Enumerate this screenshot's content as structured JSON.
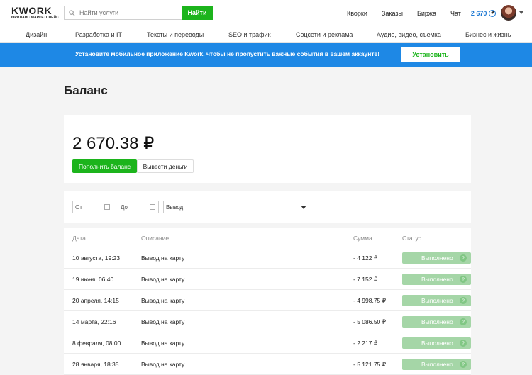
{
  "header": {
    "logo_main": "KWORK",
    "logo_sub": "ФРИЛАНС МАРКЕТПЛЕЙС",
    "search_placeholder": "Найти услуги",
    "search_button": "Найти",
    "nav": [
      "Кворки",
      "Заказы",
      "Биржа",
      "Чат"
    ],
    "balance": "2 670",
    "currency_icon": "ruble-icon"
  },
  "categories": [
    "Дизайн",
    "Разработка и IT",
    "Тексты и переводы",
    "SEO и трафик",
    "Соцсети и реклама",
    "Аудио, видео, съемка",
    "Бизнес и жизнь"
  ],
  "banner": {
    "text": "Установите мобильное приложение Kwork, чтобы не пропустить важные события в вашем аккаунте!",
    "button": "Установить",
    "color": "#1e88e5"
  },
  "page_title": "Баланс",
  "balance_card": {
    "amount": "2 670.38 ₽",
    "topup_button": "Пополнить баланс",
    "withdraw_button": "Вывести деньги"
  },
  "filters": {
    "from_placeholder": "От",
    "to_placeholder": "До",
    "type_selected": "Вывод"
  },
  "table": {
    "headers": [
      "Дата",
      "Описание",
      "Сумма",
      "Статус"
    ],
    "rows": [
      {
        "date": "10 августа, 19:23",
        "description": "Вывод на карту",
        "amount": "- 4 122 ₽",
        "status": "Выполнено"
      },
      {
        "date": "19 июня, 06:40",
        "description": "Вывод на карту",
        "amount": "- 7 152 ₽",
        "status": "Выполнено"
      },
      {
        "date": "20 апреля, 14:15",
        "description": "Вывод на карту",
        "amount": "- 4 998.75 ₽",
        "status": "Выполнено"
      },
      {
        "date": "14 марта, 22:16",
        "description": "Вывод на карту",
        "amount": "- 5 086.50 ₽",
        "status": "Выполнено"
      },
      {
        "date": "8 февраля, 08:00",
        "description": "Вывод на карту",
        "amount": "- 2 217 ₽",
        "status": "Выполнено"
      },
      {
        "date": "28 января, 18:35",
        "description": "Вывод на карту",
        "amount": "- 5 121.75 ₽",
        "status": "Выполнено"
      }
    ]
  },
  "colors": {
    "accent_green": "#1cb41c",
    "status_green": "#a5d6a7",
    "link_blue": "#1976d2"
  }
}
